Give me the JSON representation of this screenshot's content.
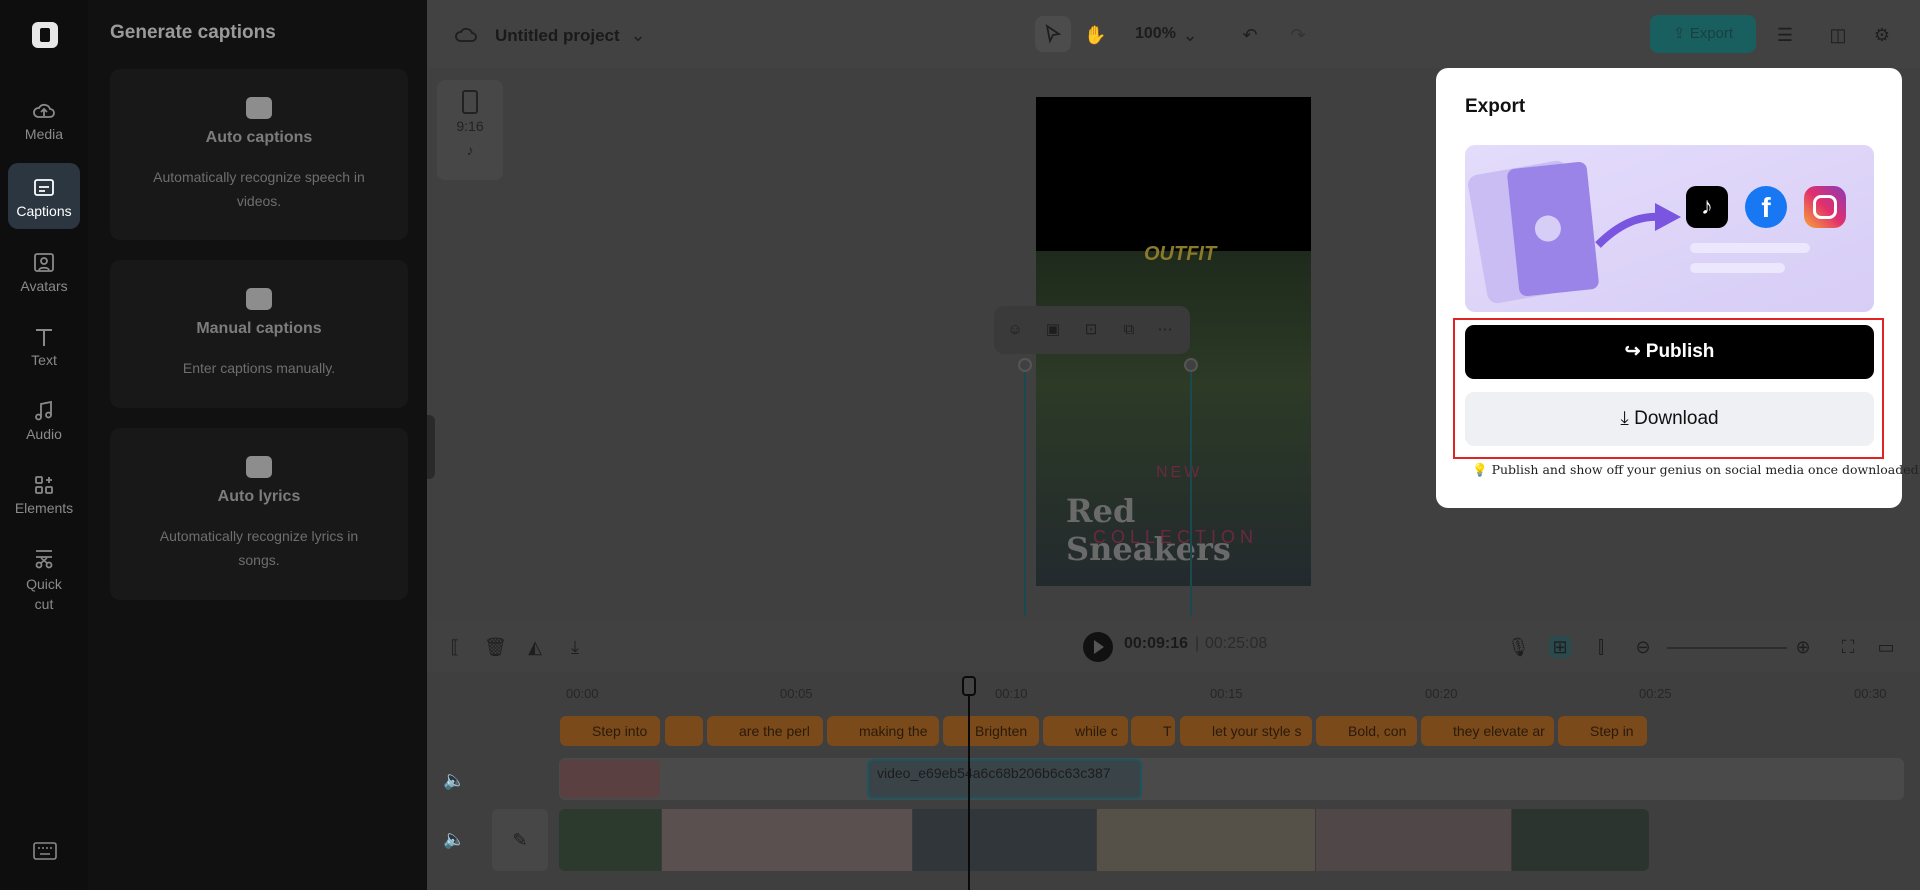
{
  "rail": {
    "items": [
      {
        "label": "Media",
        "icon": "cloud-upload-icon"
      },
      {
        "label": "Captions",
        "icon": "captions-icon",
        "active": true
      },
      {
        "label": "Avatars",
        "icon": "avatar-icon"
      },
      {
        "label": "Text",
        "icon": "text-icon"
      },
      {
        "label": "Audio",
        "icon": "music-note-icon"
      },
      {
        "label": "Elements",
        "icon": "elements-icon"
      },
      {
        "label": "Quick cut",
        "icon": "scissors-icon"
      }
    ],
    "keyboard_icon": "keyboard-icon"
  },
  "panel": {
    "title": "Generate captions",
    "cards": [
      {
        "title": "Auto captions",
        "desc": "Automatically recognize speech in videos.",
        "icon": "cc-icon"
      },
      {
        "title": "Manual captions",
        "desc": "Enter captions manually.",
        "icon": "subtitle-icon"
      },
      {
        "title": "Auto lyrics",
        "desc": "Automatically recognize lyrics in songs.",
        "icon": "lyrics-icon"
      }
    ]
  },
  "topbar": {
    "project_title": "Untitled project",
    "zoom": "100%",
    "export_label": "Export"
  },
  "canvas": {
    "ratio": "9:16",
    "outfit_text": "OUTFIT",
    "headline_text": "Red Sneakers",
    "new_text": "NEW",
    "collection_text": "COLLECTION"
  },
  "popup": {
    "title": "Export",
    "publish_label": "Publish",
    "download_label": "Download",
    "tip": "Publish and show off your genius on social media once downloaded.",
    "social": [
      "tiktok-icon",
      "facebook-icon",
      "instagram-icon"
    ]
  },
  "timeline": {
    "current_time": "00:09:16",
    "total_time": "00:25:08",
    "separator": "|",
    "ruler": [
      "00:00",
      "00:05",
      "00:10",
      "00:15",
      "00:20",
      "00:25",
      "00:30"
    ],
    "captions": [
      "Step into",
      "",
      "are the perl",
      "making the",
      "Brighten",
      "while c",
      "T",
      "let your style s",
      "Bold, con",
      "they elevate ar",
      "Step in"
    ],
    "clip_name": "video_e69eb54a6c68b206b6c63c387"
  },
  "colors": {
    "accent": "#1a5f5f",
    "highlight": "#e02424",
    "caption_chip": "#7a4a1a"
  }
}
